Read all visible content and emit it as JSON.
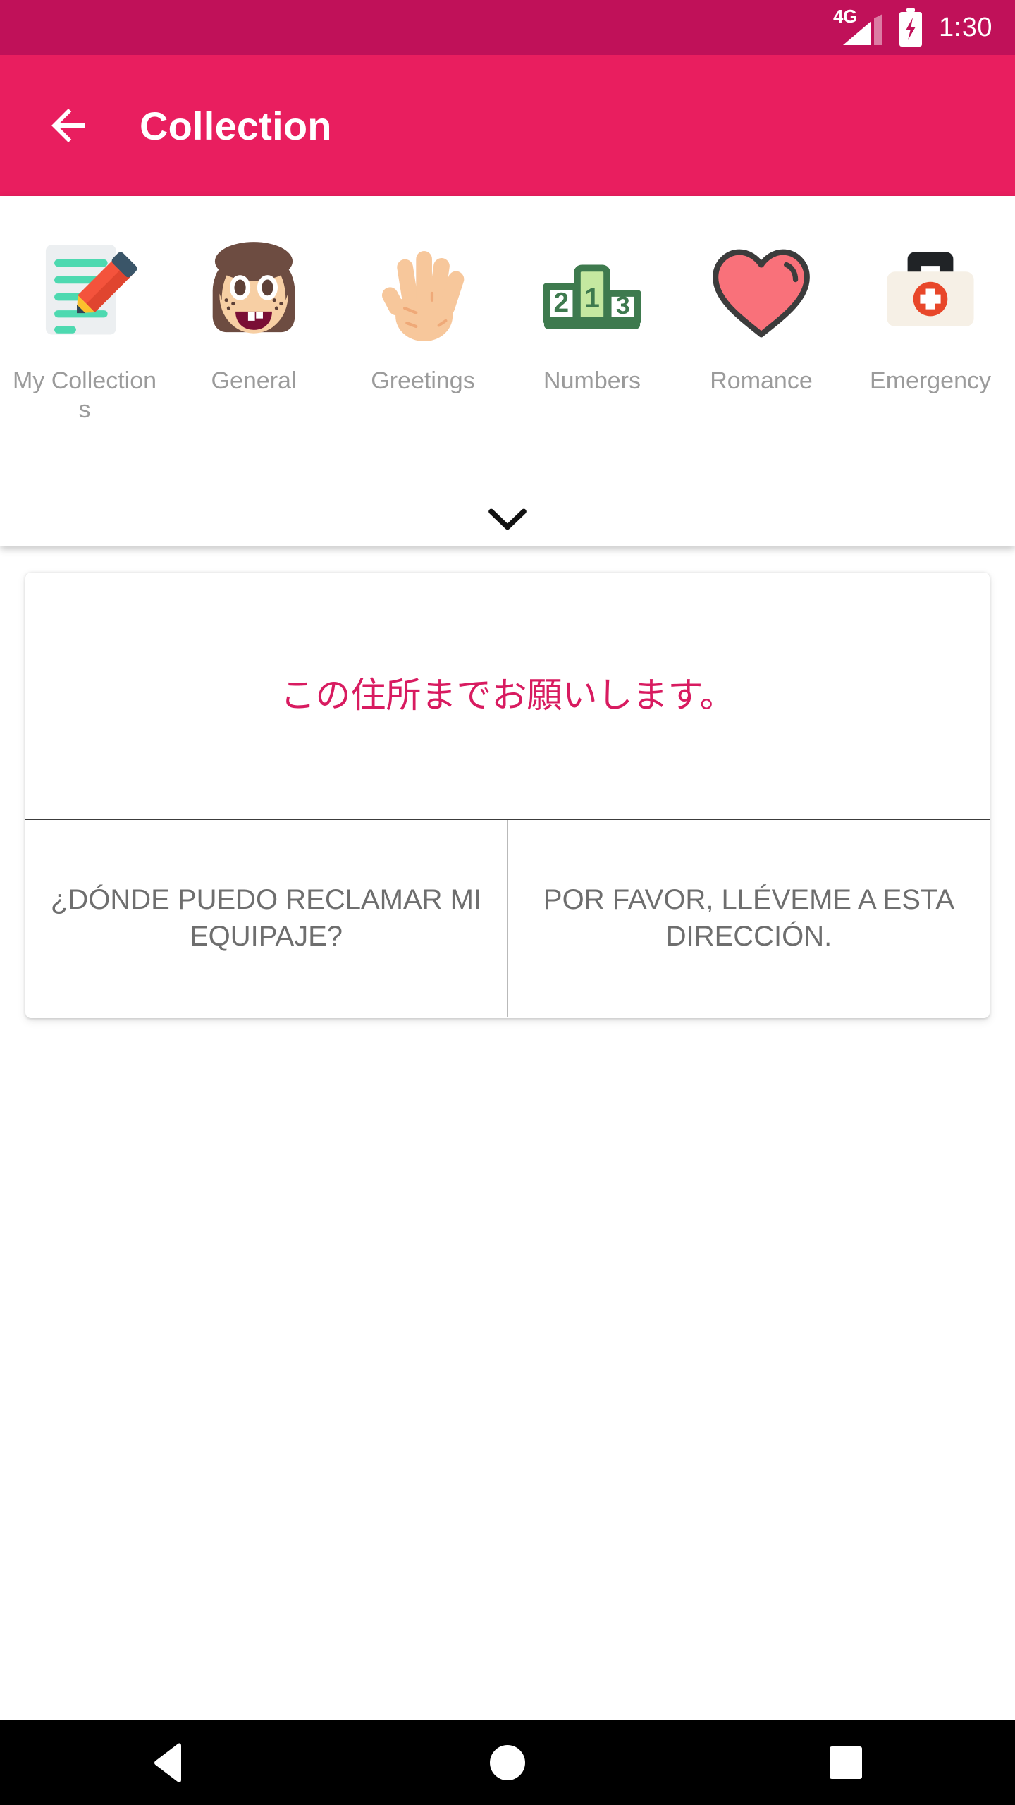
{
  "status_bar": {
    "network_label": "4G",
    "time": "1:30",
    "battery_icon": "battery-charging-icon",
    "signal_icon": "signal-bars-icon",
    "background_color": "#C01159"
  },
  "app_bar": {
    "title": "Collection",
    "back_icon": "arrow-left-icon",
    "background_color": "#E91E5F",
    "text_color": "#FFFFFF"
  },
  "categories": {
    "expand_icon": "chevron-down-icon",
    "items": [
      {
        "label": "My Collections",
        "icon": "memo-pencil-icon",
        "glyph": "📝"
      },
      {
        "label": "General",
        "icon": "girl-face-icon",
        "glyph": "👧"
      },
      {
        "label": "Greetings",
        "icon": "open-hand-icon",
        "glyph": "🖐"
      },
      {
        "label": "Numbers",
        "icon": "podium-123-icon",
        "glyph": "🏆"
      },
      {
        "label": "Romance",
        "icon": "heart-icon",
        "glyph": "❤"
      },
      {
        "label": "Emergency",
        "icon": "first-aid-kit-icon",
        "glyph": "🚑"
      }
    ]
  },
  "phrase_card": {
    "main_text": "この住所までお願いします。",
    "main_text_color": "#D81B60",
    "options": [
      {
        "text": "¿DÓNDE PUEDO RECLAMAR MI EQUIPAJE?"
      },
      {
        "text": "POR FAVOR, LLÉVEME A ESTA DIRECCIÓN."
      }
    ]
  },
  "nav_bar": {
    "background_color": "#000000",
    "buttons": [
      {
        "name": "back",
        "icon": "triangle-back-icon"
      },
      {
        "name": "home",
        "icon": "circle-home-icon"
      },
      {
        "name": "recents",
        "icon": "square-recents-icon"
      }
    ]
  }
}
